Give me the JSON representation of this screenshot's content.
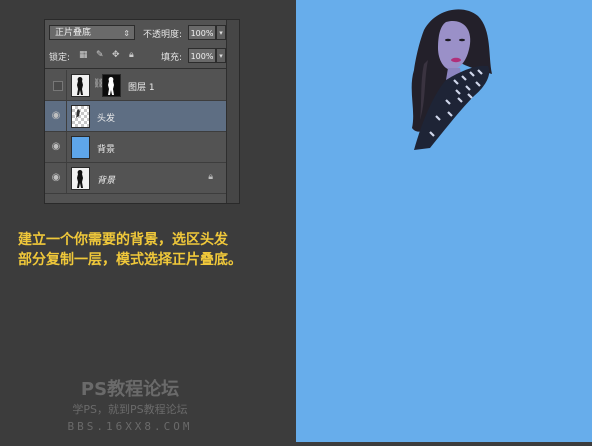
{
  "layers_panel": {
    "blend_mode": "正片叠底",
    "opacity_label": "不透明度:",
    "opacity_value": "100%",
    "lock_label": "锁定:",
    "fill_label": "填充:",
    "fill_value": "100%",
    "layers": [
      {
        "name": "图层 1",
        "visible": false,
        "has_mask": true
      },
      {
        "name": "头发",
        "visible": true,
        "selected": true
      },
      {
        "name": "背景",
        "visible": true
      },
      {
        "name": "背景",
        "visible": true,
        "locked": true,
        "italic": true
      }
    ]
  },
  "instruction": {
    "line1": "建立一个你需要的背景，选区头发",
    "line2": "部分复制一层，模式选择正片叠底。"
  },
  "watermark": {
    "title": "PS教程论坛",
    "subtitle": "学PS，就到PS教程论坛",
    "url": "BBS.16XX8.COM"
  },
  "colors": {
    "canvas_bg": "#67adeb",
    "selected_layer": "#5e6e83",
    "instruction_text": "#f0c83a"
  }
}
